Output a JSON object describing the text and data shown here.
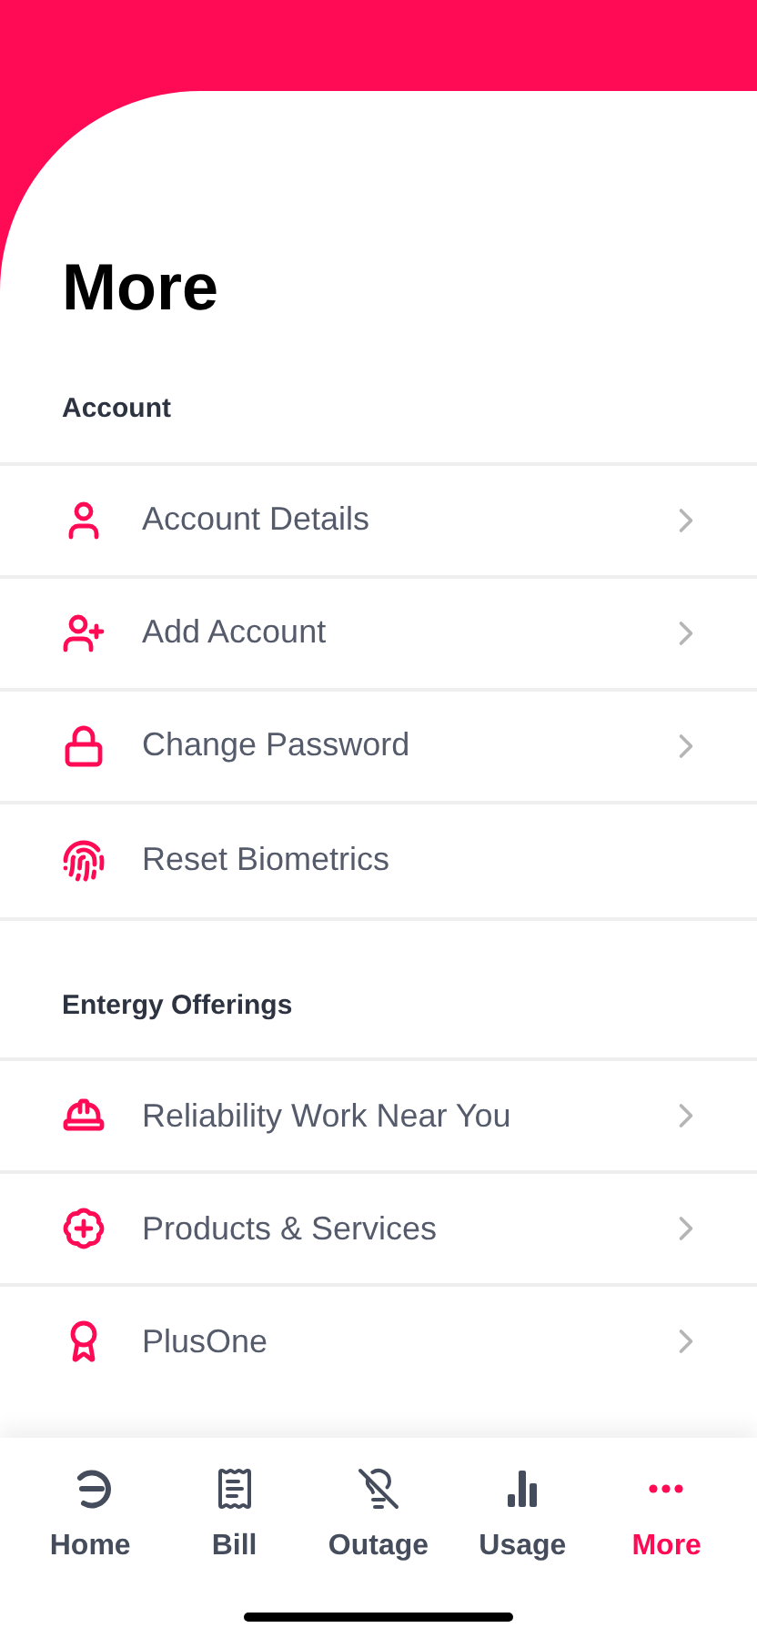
{
  "title": "More",
  "sections": [
    {
      "heading": "Account",
      "items": [
        {
          "label": "Account Details",
          "chevron": true
        },
        {
          "label": "Add Account",
          "chevron": true
        },
        {
          "label": "Change Password",
          "chevron": true
        },
        {
          "label": "Reset Biometrics",
          "chevron": false
        }
      ]
    },
    {
      "heading": "Entergy Offerings",
      "items": [
        {
          "label": "Reliability Work Near You",
          "chevron": true
        },
        {
          "label": "Products & Services",
          "chevron": true
        },
        {
          "label": "PlusOne",
          "chevron": true
        }
      ]
    }
  ],
  "nav": [
    {
      "label": "Home",
      "selected": false
    },
    {
      "label": "Bill",
      "selected": false
    },
    {
      "label": "Outage",
      "selected": false
    },
    {
      "label": "Usage",
      "selected": false
    },
    {
      "label": "More",
      "selected": true
    }
  ]
}
